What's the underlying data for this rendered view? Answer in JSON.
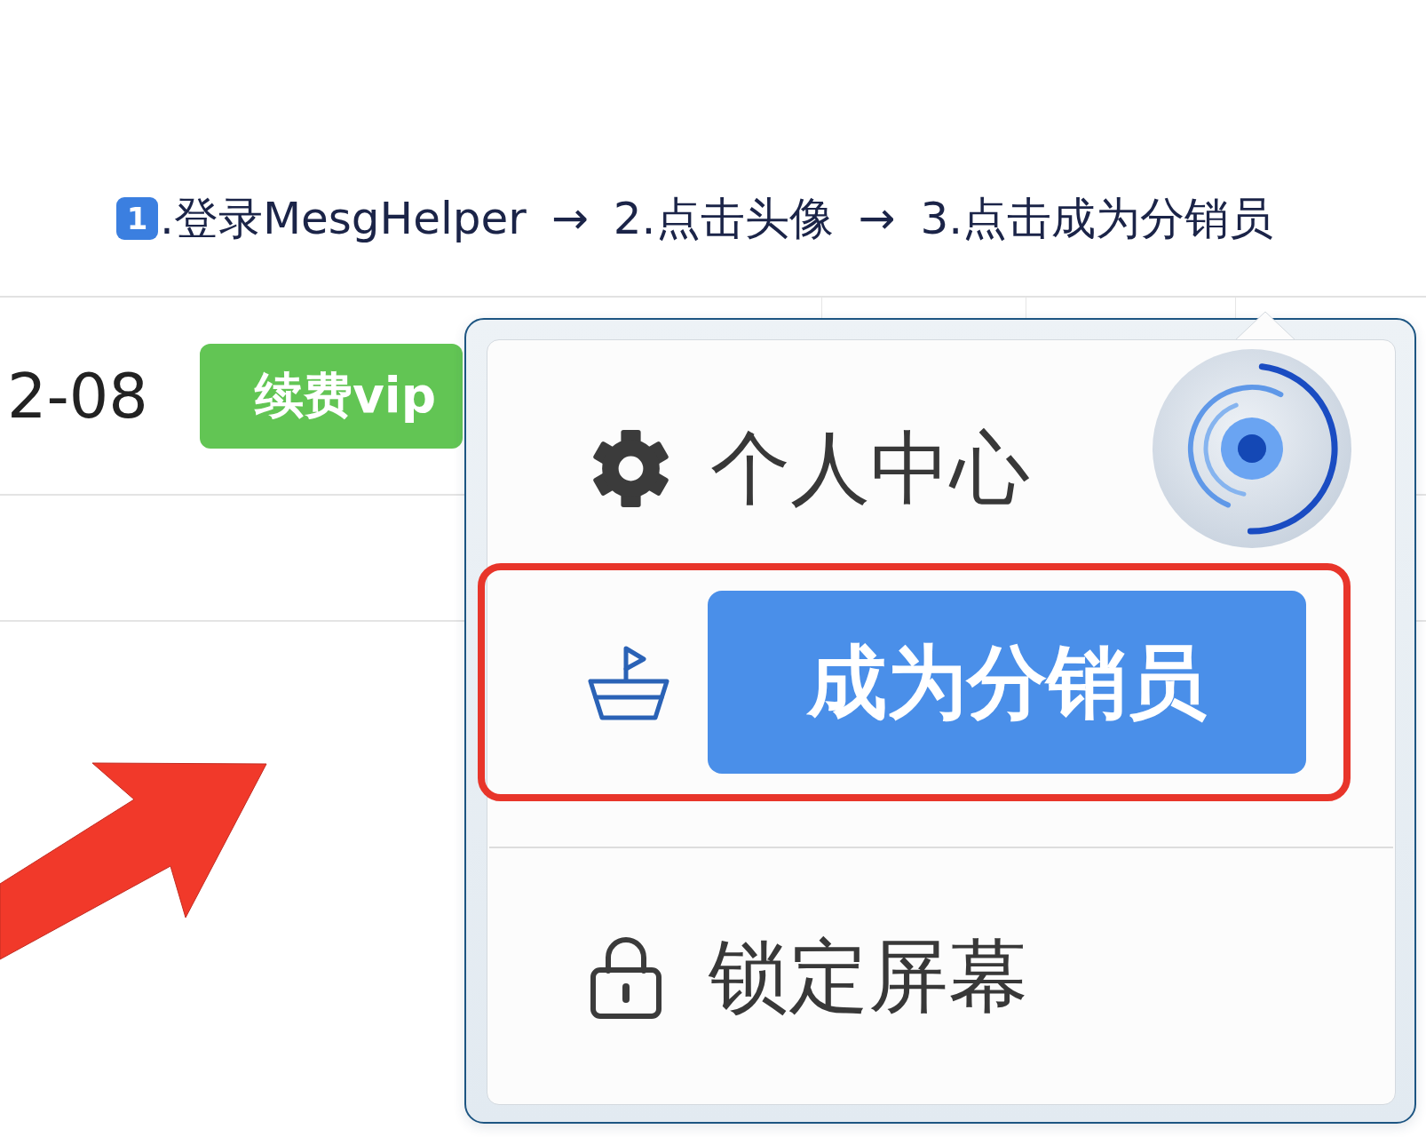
{
  "instructions": {
    "badge": "1",
    "parts": [
      {
        "kind": "step",
        "text": ".登录MesgHelper"
      },
      {
        "kind": "arrow",
        "text": "→"
      },
      {
        "kind": "step",
        "text": "2.点击头像"
      },
      {
        "kind": "arrow",
        "text": "→"
      },
      {
        "kind": "step",
        "text": "3.点击成为分销员"
      }
    ]
  },
  "table": {
    "rows": [
      {
        "date": "2-08",
        "action": "续费vip"
      }
    ]
  },
  "menu": {
    "items": [
      {
        "kind": "link",
        "label": "个人中心",
        "highlighted": false
      },
      {
        "kind": "button",
        "label": "成为分销员",
        "highlighted": true
      },
      {
        "kind": "link",
        "label": "锁定屏幕",
        "highlighted": false
      }
    ]
  }
}
